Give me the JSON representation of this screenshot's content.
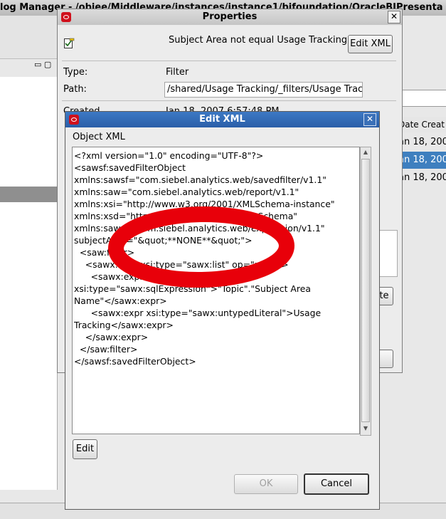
{
  "background_window": {
    "title": "log Manager - /obiee/Middleware/instances/instance1/bifoundation/OracleBIPresenta",
    "column_header": "Date Creat",
    "rows": [
      "an 18, 200",
      "an 18, 200",
      "an 18, 200"
    ]
  },
  "properties_dialog": {
    "title": "Properties",
    "close_label": "✕",
    "subject_label": "Subject Area not equal Usage Tracking",
    "edit_xml_label": "Edit XML",
    "type_label": "Type:",
    "type_value": "Filter",
    "path_label": "Path:",
    "path_value": "/shared/Usage Tracking/_filters/Usage Tracl",
    "created_label": "Created",
    "created_value": "Jan 18, 2007 6:57:48 PM",
    "partial_button_label": "te"
  },
  "edit_xml_dialog": {
    "title": "Edit XML",
    "close_label": "✕",
    "section_label": "Object XML",
    "xml_lines": [
      "<?xml version=\"1.0\" encoding=\"UTF-8\"?>",
      "<sawsf:savedFilterObject",
      "xmlns:sawsf=\"com.siebel.analytics.web/savedfilter/v1.1\"",
      "xmlns:saw=\"com.siebel.analytics.web/report/v1.1\"",
      "xmlns:xsi=\"http://www.w3.org/2001/XMLSchema-instance\"",
      "xmlns:xsd=\"http://www.w3.org/2001/XMLSchema\"",
      "xmlns:sawx=\"com.siebel.analytics.web/expression/v1.1\"",
      "subjectArea=\"&quot;**NONE**&quot;\">",
      "  <saw:filter>",
      "    <sawx:expr xsi:type=\"sawx:list\" op=\"notIn\">",
      "      <sawx:expr",
      "xsi:type=\"sawx:sqlExpression\">\"Topic\".\"Subject Area",
      "Name\"</sawx:expr>",
      "      <sawx:expr xsi:type=\"sawx:untypedLiteral\">Usage",
      "Tracking</sawx:expr>",
      "    </sawx:expr>",
      "  </saw:filter>",
      "</sawsf:savedFilterObject>"
    ],
    "edit_label": "Edit",
    "ok_label": "OK",
    "cancel_label": "Cancel"
  },
  "colors": {
    "annotation_red": "#e8000a",
    "title_active": "#2f66b0",
    "selection": "#3e7fbf"
  }
}
